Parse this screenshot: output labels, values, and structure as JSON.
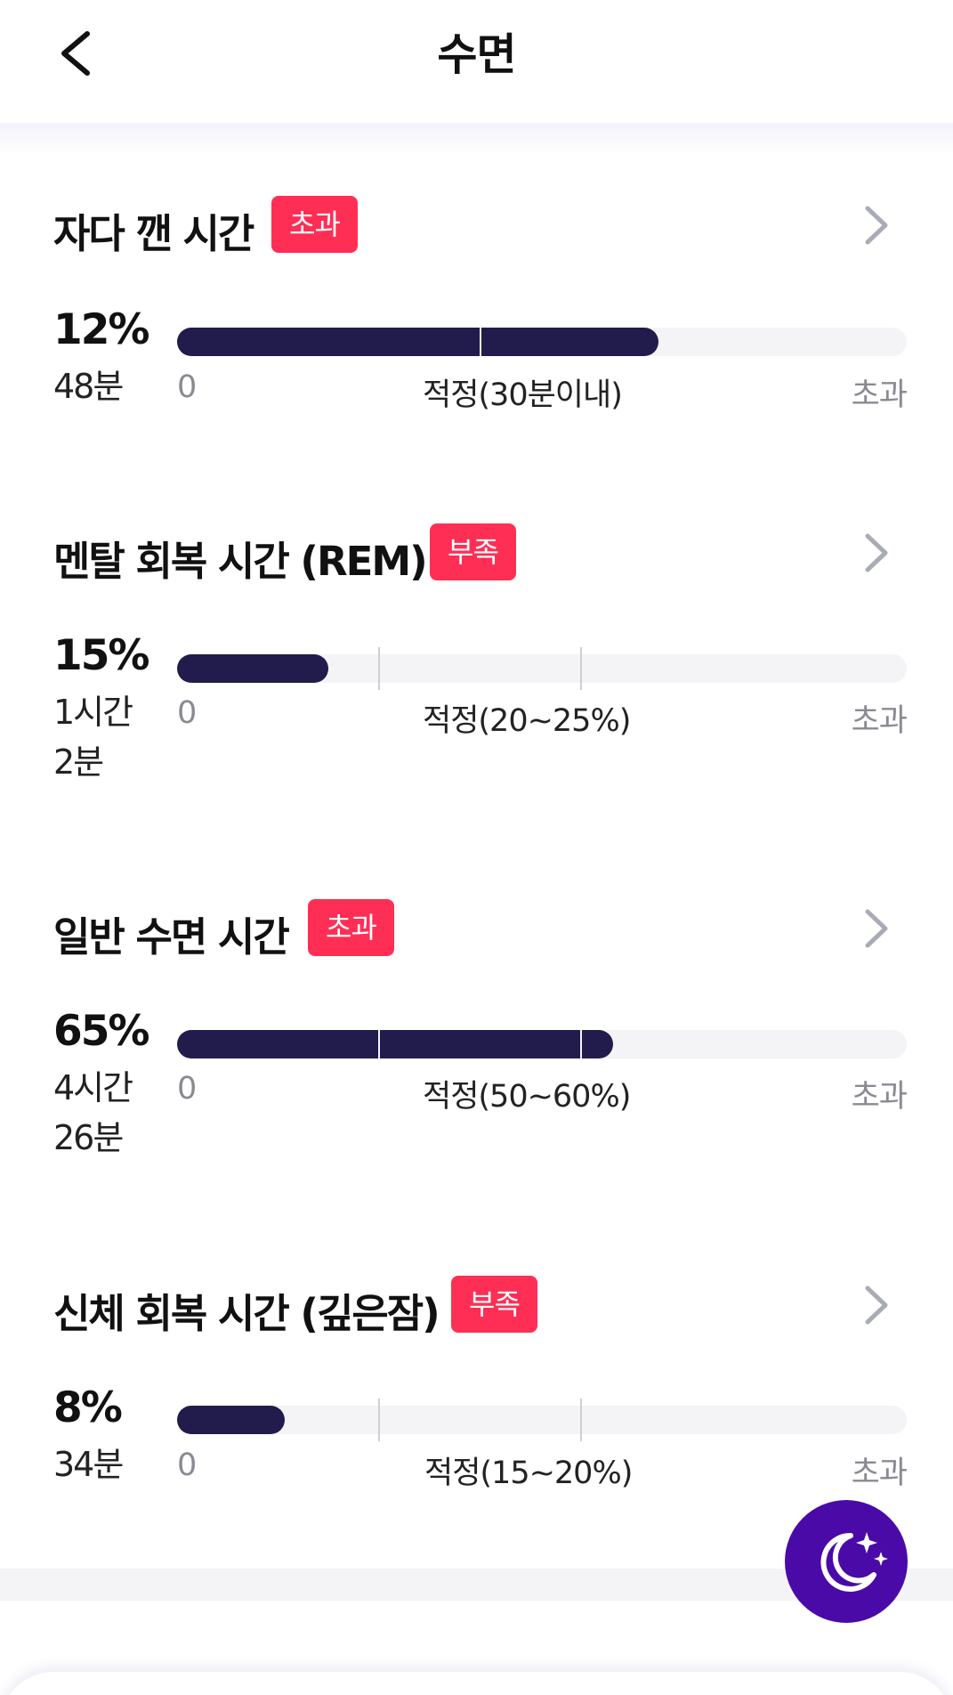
{
  "header": {
    "title": "수면"
  },
  "sections": [
    {
      "title": "자다 깬 시간",
      "badge": "초과",
      "percent": "12%",
      "duration": "48분",
      "scale": {
        "min": "0",
        "mid": "적정(30분이내)",
        "max": "초과"
      },
      "fill_fraction": 0.66,
      "markers": [
        0.415
      ],
      "badge_color": "#ff2e55"
    },
    {
      "title": "멘탈 회복 시간 (REM)",
      "badge": "부족",
      "percent": "15%",
      "duration": "1시간 2분",
      "scale": {
        "min": "0",
        "mid": "적정(20~25%)",
        "max": "초과"
      },
      "fill_fraction": 0.207,
      "markers": [
        0.275,
        0.553
      ],
      "badge_color": "#ff2e55"
    },
    {
      "title": "일반 수면 시간",
      "badge": "초과",
      "percent": "65%",
      "duration": "4시간 26분",
      "scale": {
        "min": "0",
        "mid": "적정(50~60%)",
        "max": "초과"
      },
      "fill_fraction": 0.597,
      "markers": [
        0.275,
        0.553
      ],
      "badge_color": "#ff2e55"
    },
    {
      "title": "신체 회복 시간 (깊은잠)",
      "badge": "부족",
      "percent": "8%",
      "duration": "34분",
      "scale": {
        "min": "0",
        "mid": "적정(15~20%)",
        "max": "초과"
      },
      "fill_fraction": 0.148,
      "markers": [
        0.275,
        0.553
      ],
      "badge_color": "#ff2e55"
    }
  ],
  "icons": {
    "back": "chevron-left-icon",
    "section_nav": "chevron-right-icon",
    "fab": "moon-stars-icon"
  },
  "colors": {
    "bar_fill": "#221c4d",
    "bar_track": "#f4f4f6",
    "fab": "#4a0aa8",
    "badge": "#ff2e55"
  }
}
